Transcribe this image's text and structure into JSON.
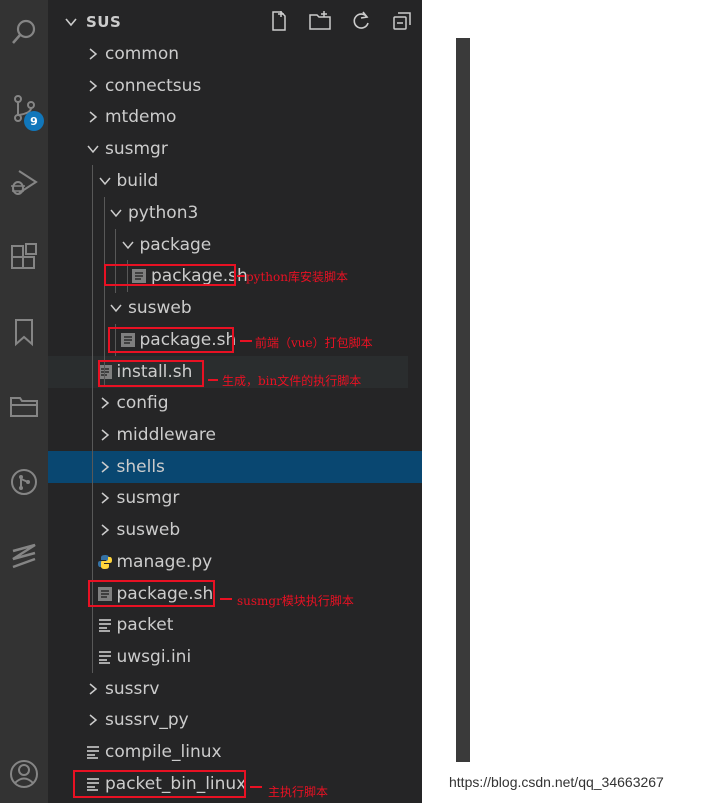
{
  "colors": {
    "activity_bar": "#333333",
    "sidebar": "#252526",
    "selection": "#094771",
    "badge": "#1177bb",
    "annotation": "#e81123"
  },
  "activity_bar": {
    "icons": [
      "search-icon",
      "source-control-icon",
      "run-debug-icon",
      "extensions-icon",
      "bookmarks-icon",
      "folder-icon",
      "git-graph-icon",
      "sus-logo-icon",
      "account-icon"
    ],
    "source_control_badge": "9"
  },
  "explorer": {
    "title": "SUS",
    "actions": [
      "new-file-icon",
      "new-folder-icon",
      "refresh-icon",
      "collapse-all-icon"
    ],
    "tree": [
      {
        "label": "common",
        "kind": "folder",
        "expanded": false
      },
      {
        "label": "connectsus",
        "kind": "folder",
        "expanded": false
      },
      {
        "label": "mtdemo",
        "kind": "folder",
        "expanded": false
      },
      {
        "label": "susmgr",
        "kind": "folder",
        "expanded": true
      },
      {
        "label": "build",
        "kind": "folder",
        "expanded": true
      },
      {
        "label": "python3",
        "kind": "folder",
        "expanded": true
      },
      {
        "label": "package",
        "kind": "folder",
        "expanded": true
      },
      {
        "label": "package.sh",
        "kind": "shell-file"
      },
      {
        "label": "susweb",
        "kind": "folder",
        "expanded": true
      },
      {
        "label": "package.sh",
        "kind": "shell-file"
      },
      {
        "label": "install.sh",
        "kind": "shell-file"
      },
      {
        "label": "config",
        "kind": "folder",
        "expanded": false
      },
      {
        "label": "middleware",
        "kind": "folder",
        "expanded": false
      },
      {
        "label": "shells",
        "kind": "folder",
        "expanded": false,
        "selected": true
      },
      {
        "label": "susmgr",
        "kind": "folder",
        "expanded": false
      },
      {
        "label": "susweb",
        "kind": "folder",
        "expanded": false
      },
      {
        "label": "manage.py",
        "kind": "python-file"
      },
      {
        "label": "package.sh",
        "kind": "shell-file"
      },
      {
        "label": "packet",
        "kind": "text-file"
      },
      {
        "label": "uwsgi.ini",
        "kind": "text-file"
      },
      {
        "label": "sussrv",
        "kind": "folder",
        "expanded": false
      },
      {
        "label": "sussrv_py",
        "kind": "folder",
        "expanded": false
      },
      {
        "label": "compile_linux",
        "kind": "text-file"
      },
      {
        "label": "packet_bin_linux",
        "kind": "text-file"
      }
    ]
  },
  "annotations": {
    "python_package": "python库安装脚本",
    "web_package": "前端（vue）打包脚本",
    "install": "生成，bin文件的执行脚本",
    "susmgr_package": "susmgr模块执行脚本",
    "main_packet": "主执行脚本"
  },
  "watermark": "https://blog.csdn.net/qq_34663267"
}
